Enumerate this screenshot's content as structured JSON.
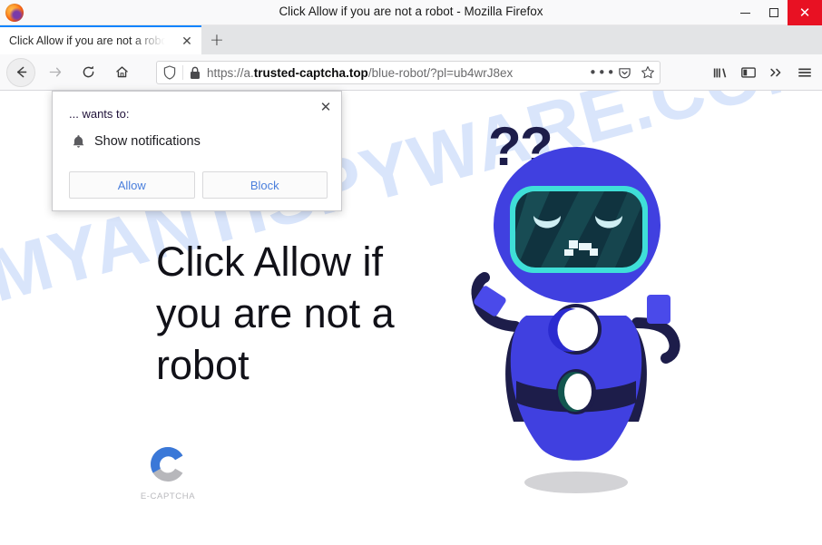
{
  "window": {
    "title": "Click Allow if you are not a robot - Mozilla Firefox",
    "minimize_label": "—",
    "maximize_label": "□",
    "close_label": "✕",
    "logo_name": "firefox-logo"
  },
  "tabs": {
    "active": {
      "title": "Click Allow if you are not a robot",
      "close_label": "✕"
    },
    "new_tab_label": "+"
  },
  "nav": {
    "back_label": "←",
    "forward_label": "→",
    "reload_label": "↻",
    "home_label": "⌂"
  },
  "urlbar": {
    "scheme": "https://",
    "subdomain": "a.",
    "domain": "trusted-captcha.top",
    "path": "/blue-robot/?pl=ub4wrJ8ex",
    "full_url": "https://a.trusted-captcha.top/blue-robot/?pl=ub4wrJ8ex",
    "page_actions_label": "•••",
    "pocket_label": "pocket-icon",
    "bookmark_label": "☆"
  },
  "toolbar_right": {
    "library_label": "library-icon",
    "sidebar_label": "sidebar-icon",
    "overflow_label": "»",
    "menu_label": "menu-icon"
  },
  "permission_popup": {
    "origin_text": "... wants to:",
    "permission_label": "Show notifications",
    "allow_label": "Allow",
    "block_label": "Block",
    "close_label": "✕"
  },
  "page": {
    "headline": "Click Allow if you are not a robot",
    "watermark": "MYANTISPYWARE.COM",
    "brand_label": "E-CAPTCHA",
    "question_marks": "??"
  },
  "colors": {
    "accent_blue": "#3b3bd6",
    "link_blue": "#4a7fdc",
    "close_red": "#e81123",
    "watermark_blue": "#d9e5fb",
    "robot_body": "#4040e0",
    "robot_dark": "#1d1d4a",
    "visor_cyan": "#3fdfd8",
    "visor_dark": "#10333f",
    "tab_accent": "#0a84ff",
    "captcha_blue": "#3a78d8",
    "captcha_gray": "#b7b7bb"
  }
}
